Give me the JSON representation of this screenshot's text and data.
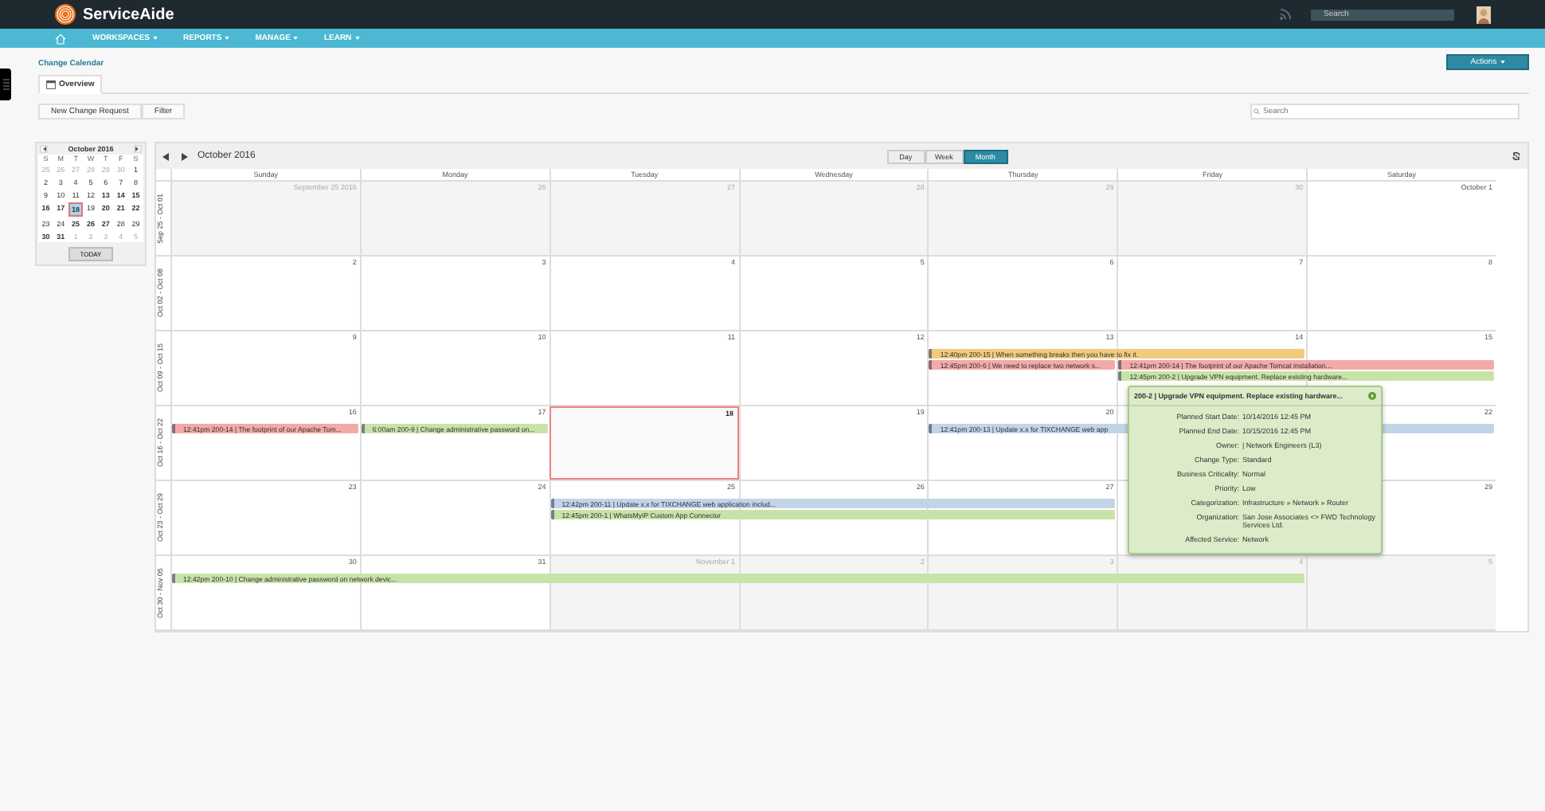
{
  "header": {
    "brand": "ServiceAide",
    "search": {
      "placeholder": "Search"
    }
  },
  "nav": [
    "WORKSPACES",
    "REPORTS",
    "MANAGE",
    "LEARN"
  ],
  "page": {
    "breadcrumb": "Change Calendar",
    "actions": "Actions"
  },
  "tabs": [
    {
      "label": "Overview",
      "selected": true
    }
  ],
  "toolbar": {
    "buttons": [
      "New Change Request",
      "Filter"
    ],
    "search": {
      "placeholder": "Search"
    }
  },
  "mini_calendar": {
    "title": "October 2016",
    "weekdays": [
      "S",
      "M",
      "T",
      "W",
      "T",
      "F",
      "S"
    ],
    "today_button": "TODAY",
    "weeks": [
      [
        {
          "day": "25",
          "muted": true,
          "bold": false,
          "selected": false
        },
        {
          "day": "26",
          "muted": true,
          "bold": false,
          "selected": false
        },
        {
          "day": "27",
          "muted": true,
          "bold": false,
          "selected": false
        },
        {
          "day": "28",
          "muted": true,
          "bold": false,
          "selected": false
        },
        {
          "day": "29",
          "muted": true,
          "bold": false,
          "selected": false
        },
        {
          "day": "30",
          "muted": true,
          "bold": false,
          "selected": false
        },
        {
          "day": "1",
          "muted": false,
          "bold": false,
          "selected": false
        }
      ],
      [
        {
          "day": "2",
          "muted": false,
          "bold": false,
          "selected": false
        },
        {
          "day": "3",
          "muted": false,
          "bold": false,
          "selected": false
        },
        {
          "day": "4",
          "muted": false,
          "bold": false,
          "selected": false
        },
        {
          "day": "5",
          "muted": false,
          "bold": false,
          "selected": false
        },
        {
          "day": "6",
          "muted": false,
          "bold": false,
          "selected": false
        },
        {
          "day": "7",
          "muted": false,
          "bold": false,
          "selected": false
        },
        {
          "day": "8",
          "muted": false,
          "bold": false,
          "selected": false
        }
      ],
      [
        {
          "day": "9",
          "muted": false,
          "bold": false,
          "selected": false
        },
        {
          "day": "10",
          "muted": false,
          "bold": false,
          "selected": false
        },
        {
          "day": "11",
          "muted": false,
          "bold": false,
          "selected": false
        },
        {
          "day": "12",
          "muted": false,
          "bold": false,
          "selected": false
        },
        {
          "day": "13",
          "muted": false,
          "bold": true,
          "selected": false
        },
        {
          "day": "14",
          "muted": false,
          "bold": true,
          "selected": false
        },
        {
          "day": "15",
          "muted": false,
          "bold": true,
          "selected": false
        }
      ],
      [
        {
          "day": "16",
          "muted": false,
          "bold": true,
          "selected": false
        },
        {
          "day": "17",
          "muted": false,
          "bold": true,
          "selected": false
        },
        {
          "day": "18",
          "muted": false,
          "bold": true,
          "selected": true
        },
        {
          "day": "19",
          "muted": false,
          "bold": false,
          "selected": false
        },
        {
          "day": "20",
          "muted": false,
          "bold": true,
          "selected": false
        },
        {
          "day": "21",
          "muted": false,
          "bold": true,
          "selected": false
        },
        {
          "day": "22",
          "muted": false,
          "bold": true,
          "selected": false
        }
      ],
      [
        {
          "day": "23",
          "muted": false,
          "bold": false,
          "selected": false
        },
        {
          "day": "24",
          "muted": false,
          "bold": false,
          "selected": false
        },
        {
          "day": "25",
          "muted": false,
          "bold": true,
          "selected": false
        },
        {
          "day": "26",
          "muted": false,
          "bold": true,
          "selected": false
        },
        {
          "day": "27",
          "muted": false,
          "bold": true,
          "selected": false
        },
        {
          "day": "28",
          "muted": false,
          "bold": false,
          "selected": false
        },
        {
          "day": "29",
          "muted": false,
          "bold": false,
          "selected": false
        }
      ],
      [
        {
          "day": "30",
          "muted": false,
          "bold": true,
          "selected": false
        },
        {
          "day": "31",
          "muted": false,
          "bold": true,
          "selected": false
        },
        {
          "day": "1",
          "muted": true,
          "bold": false,
          "selected": false
        },
        {
          "day": "2",
          "muted": true,
          "bold": false,
          "selected": false
        },
        {
          "day": "3",
          "muted": true,
          "bold": false,
          "selected": false
        },
        {
          "day": "4",
          "muted": true,
          "bold": false,
          "selected": false
        },
        {
          "day": "5",
          "muted": true,
          "bold": false,
          "selected": false
        }
      ]
    ]
  },
  "calendar": {
    "title": "October 2016",
    "views": [
      {
        "label": "Day",
        "selected": false
      },
      {
        "label": "Week",
        "selected": false
      },
      {
        "label": "Month",
        "selected": true
      }
    ],
    "weekdays": [
      "Sunday",
      "Monday",
      "Tuesday",
      "Wednesday",
      "Thursday",
      "Friday",
      "Saturday"
    ],
    "weeks": [
      {
        "label": "Sep 25 - Oct 01",
        "days": [
          {
            "label": "September 25 2016",
            "other_month": true,
            "today": false
          },
          {
            "label": "26",
            "other_month": true,
            "today": false
          },
          {
            "label": "27",
            "other_month": true,
            "today": false
          },
          {
            "label": "28",
            "other_month": true,
            "today": false
          },
          {
            "label": "29",
            "other_month": true,
            "today": false
          },
          {
            "label": "30",
            "other_month": true,
            "today": false
          },
          {
            "label": "October 1",
            "other_month": false,
            "today": false
          }
        ]
      },
      {
        "label": "Oct 02 - Oct 08",
        "days": [
          {
            "label": "2",
            "other_month": false,
            "today": false
          },
          {
            "label": "3",
            "other_month": false,
            "today": false
          },
          {
            "label": "4",
            "other_month": false,
            "today": false
          },
          {
            "label": "5",
            "other_month": false,
            "today": false
          },
          {
            "label": "6",
            "other_month": false,
            "today": false
          },
          {
            "label": "7",
            "other_month": false,
            "today": false
          },
          {
            "label": "8",
            "other_month": false,
            "today": false
          }
        ]
      },
      {
        "label": "Oct 09 - Oct 15",
        "days": [
          {
            "label": "9",
            "other_month": false,
            "today": false
          },
          {
            "label": "10",
            "other_month": false,
            "today": false
          },
          {
            "label": "11",
            "other_month": false,
            "today": false
          },
          {
            "label": "12",
            "other_month": false,
            "today": false
          },
          {
            "label": "13",
            "other_month": false,
            "today": false
          },
          {
            "label": "14",
            "other_month": false,
            "today": false
          },
          {
            "label": "15",
            "other_month": false,
            "today": false
          }
        ],
        "lanes": [
          [
            {
              "kind": "empty"
            },
            {
              "kind": "empty"
            },
            {
              "kind": "empty"
            },
            {
              "kind": "empty"
            },
            {
              "kind": "event",
              "text": "12:40pm 200-15 | When something breaks then you have to fix it.",
              "color": "#f2cb7c"
            },
            {
              "kind": "continued"
            },
            {
              "kind": "empty"
            }
          ],
          [
            {
              "kind": "empty"
            },
            {
              "kind": "empty"
            },
            {
              "kind": "empty"
            },
            {
              "kind": "empty"
            },
            {
              "kind": "event",
              "text": "12:45pm 200-6 | We need to replace two network s...",
              "color": "#f4a9a9"
            },
            {
              "kind": "event",
              "text": "12:41pm 200-14 | The footprint of our Apache Tomcat installation...",
              "color": "#f4a9a9"
            },
            {
              "kind": "continued"
            }
          ],
          [
            {
              "kind": "empty"
            },
            {
              "kind": "empty"
            },
            {
              "kind": "empty"
            },
            {
              "kind": "empty"
            },
            {
              "kind": "empty"
            },
            {
              "kind": "event",
              "text": "12:45pm 200-2 | Upgrade VPN equipment. Replace existing hardware...",
              "color": "#c8e3a8"
            },
            {
              "kind": "continued"
            }
          ]
        ]
      },
      {
        "label": "Oct 16 - Oct 22",
        "days": [
          {
            "label": "16",
            "other_month": false,
            "today": false
          },
          {
            "label": "17",
            "other_month": false,
            "today": false
          },
          {
            "label": "18",
            "other_month": false,
            "today": true
          },
          {
            "label": "19",
            "other_month": false,
            "today": false
          },
          {
            "label": "20",
            "other_month": false,
            "today": false
          },
          {
            "label": "22",
            "other_month": false,
            "today": false,
            "after_covered_day": true
          }
        ],
        "lanes": [
          [
            {
              "kind": "event",
              "text": "12:41pm 200-14 | The footprint of our Apache Tom...",
              "color": "#f4a9a9"
            },
            {
              "kind": "event",
              "text": "6:00am 200-9 | Change administrative password on...",
              "color": "#c8e3a8"
            },
            {
              "kind": "empty"
            },
            {
              "kind": "empty"
            },
            {
              "kind": "event",
              "text": "12:41pm 200-13 | Update x.x for TIXCHANGE web app",
              "color": "#c2d4e8"
            },
            {
              "kind": "continued"
            },
            {
              "kind": "continued"
            }
          ]
        ]
      },
      {
        "label": "Oct 23 - Oct 29",
        "days": [
          {
            "label": "23",
            "other_month": false,
            "today": false
          },
          {
            "label": "24",
            "other_month": false,
            "today": false
          },
          {
            "label": "25",
            "other_month": false,
            "today": false
          },
          {
            "label": "26",
            "other_month": false,
            "today": false
          },
          {
            "label": "27",
            "other_month": false,
            "today": false
          },
          {
            "label": "29",
            "other_month": false,
            "today": false,
            "after_covered_day": true
          }
        ],
        "lanes": [
          [
            {
              "kind": "empty"
            },
            {
              "kind": "empty"
            },
            {
              "kind": "event",
              "text": "12:42pm 200-11 | Update x.x for TIXCHANGE web application includ...",
              "color": "#c2d4e8"
            },
            {
              "kind": "continued"
            },
            {
              "kind": "continued"
            },
            {
              "kind": "empty"
            },
            {
              "kind": "empty"
            }
          ],
          [
            {
              "kind": "empty"
            },
            {
              "kind": "empty"
            },
            {
              "kind": "event",
              "text": "12:45pm 200-1 | WhatsMyIP Custom App Connector",
              "color": "#c8e3a8"
            },
            {
              "kind": "continued"
            },
            {
              "kind": "continued"
            },
            {
              "kind": "empty"
            },
            {
              "kind": "empty"
            }
          ]
        ]
      },
      {
        "label": "Oct 30 - Nov 05",
        "days": [
          {
            "label": "30",
            "other_month": false,
            "today": false
          },
          {
            "label": "31",
            "other_month": false,
            "today": false
          },
          {
            "label": "November 1",
            "other_month": true,
            "today": false
          },
          {
            "label": "2",
            "other_month": true,
            "today": false
          },
          {
            "label": "3",
            "other_month": true,
            "today": false
          },
          {
            "label": "4",
            "other_month": true,
            "today": false
          },
          {
            "label": "5",
            "other_month": true,
            "today": false
          }
        ],
        "lanes": [
          [
            {
              "kind": "event",
              "text": "12:42pm 200-10 | Change administrative password on network devic...",
              "color": "#c8e3a8"
            },
            {
              "kind": "continued"
            },
            {
              "kind": "continued"
            },
            {
              "kind": "continued"
            },
            {
              "kind": "continued"
            },
            {
              "kind": "continued"
            },
            {
              "kind": "empty"
            }
          ]
        ]
      }
    ]
  },
  "tooltip": {
    "title": "200-2 | Upgrade VPN equipment. Replace existing hardware...",
    "rows": [
      {
        "label": "Planned Start Date:",
        "value": "10/14/2016 12:45 PM"
      },
      {
        "label": "Planned End Date:",
        "value": "10/15/2016 12:45 PM"
      },
      {
        "label": "Owner:",
        "value": "| Network Engineers (L3)"
      },
      {
        "label": "Change Type:",
        "value": "Standard"
      },
      {
        "label": "Business Criticality:",
        "value": "Normal"
      },
      {
        "label": "Priority:",
        "value": "Low"
      },
      {
        "label": "Categorization:",
        "value": "Infrastructure » Network » Router"
      },
      {
        "label": "Organization:",
        "value": "San Jose Associates <> FWD Technology Services Ltd."
      },
      {
        "label": "Affected Service:",
        "value": "Network"
      }
    ]
  }
}
